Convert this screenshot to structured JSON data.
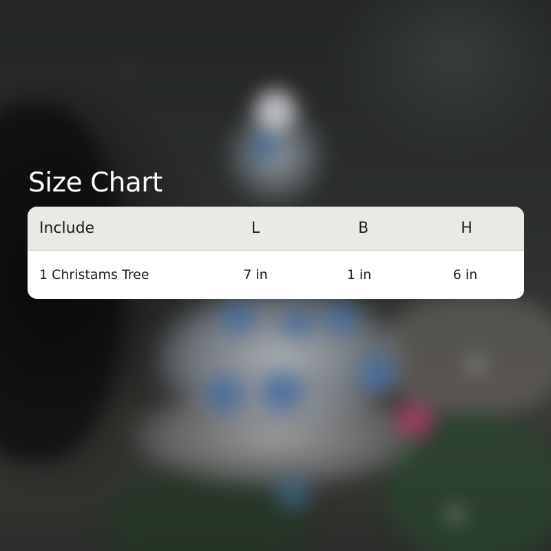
{
  "title": "Size Chart",
  "table": {
    "headers": [
      "Include",
      "L",
      "B",
      "H"
    ],
    "rows": [
      [
        "1 Christams Tree",
        "7 in",
        "1 in",
        "6 in"
      ]
    ]
  },
  "colors": {
    "title_text": "#ffffff",
    "header_background": "#ebe9e4",
    "row_background": "#ffffff",
    "cell_text": "#1b1b1b"
  }
}
